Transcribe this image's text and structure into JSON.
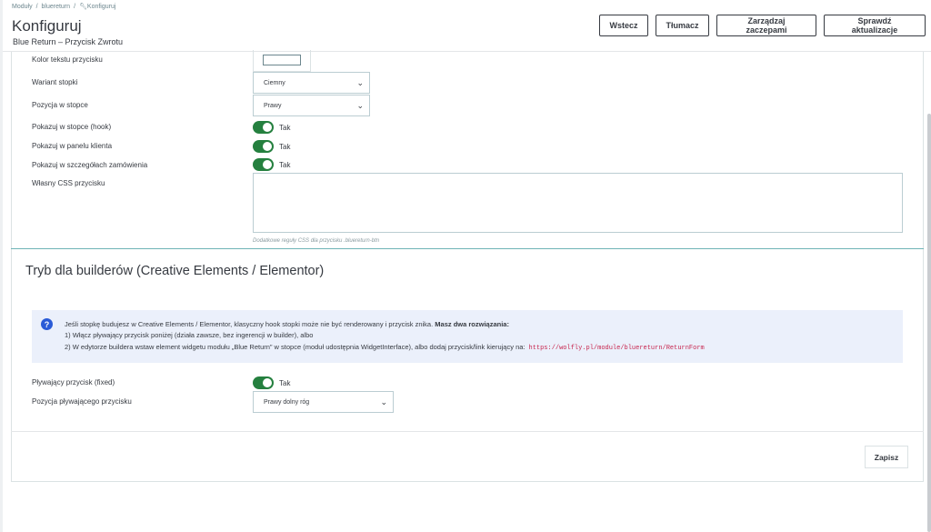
{
  "breadcrumb": {
    "items": [
      "Moduły",
      "bluereturn"
    ],
    "current": "Konfiguruj",
    "wrench_icon": "wrench-icon"
  },
  "header": {
    "title": "Konfiguruj",
    "subtitle": "Blue Return – Przycisk Zwrotu"
  },
  "toolbar": {
    "back": "Wstecz",
    "translate": "Tłumacz",
    "hooks": "Zarządzaj zaczepami",
    "updates": "Sprawdź aktualizacje"
  },
  "form": {
    "text_color": {
      "label": "Kolor tekstu przycisku",
      "value": "#ffffff"
    },
    "footer_variant": {
      "label": "Wariant stopki",
      "value": "Ciemny"
    },
    "footer_position": {
      "label": "Pozycja w stopce",
      "value": "Prawy"
    },
    "show_footer_hook": {
      "label": "Pokazuj w stopce (hook)",
      "state": "Tak"
    },
    "show_customer_panel": {
      "label": "Pokazuj w panelu klienta",
      "state": "Tak"
    },
    "show_order_details": {
      "label": "Pokazuj w szczegółach zamówienia",
      "state": "Tak"
    },
    "custom_css": {
      "label": "Własny CSS przycisku",
      "value": "",
      "help": "Dodatkowe reguły CSS dla przycisku .bluereturn-btn"
    }
  },
  "builder": {
    "title": "Tryb dla builderów (Creative Elements / Elementor)",
    "alert": {
      "icon": "question-circle-icon",
      "intro": "Jeśli stopkę budujesz w Creative Elements / Elementor, klasyczny hook stopki może nie być renderowany i przycisk znika.",
      "intro_bold": "Masz dwa rozwiązania:",
      "option1": "1) Włącz pływający przycisk poniżej (działa zawsze, bez ingerencji w builder), albo",
      "option2": "2) W edytorze buildera wstaw element widgetu modułu „Blue Return” w stopce (moduł udostępnia WidgetInterface), albo dodaj przycisk/link kierujący na:",
      "url": "https://wolfly.pl/module/bluereturn/ReturnForm"
    },
    "floating": {
      "label": "Pływający przycisk (fixed)",
      "state": "Tak"
    },
    "floating_position": {
      "label": "Pozycja pływającego przycisku",
      "value": "Prawy dolny róg"
    }
  },
  "footer": {
    "save": "Zapisz"
  },
  "colors": {
    "toggle_on": "#25803f",
    "alert_bg": "#ebf0fb",
    "alert_icon": "#2a5bd7",
    "url": "#c7254e",
    "section_rule": "#6fb4b6"
  }
}
